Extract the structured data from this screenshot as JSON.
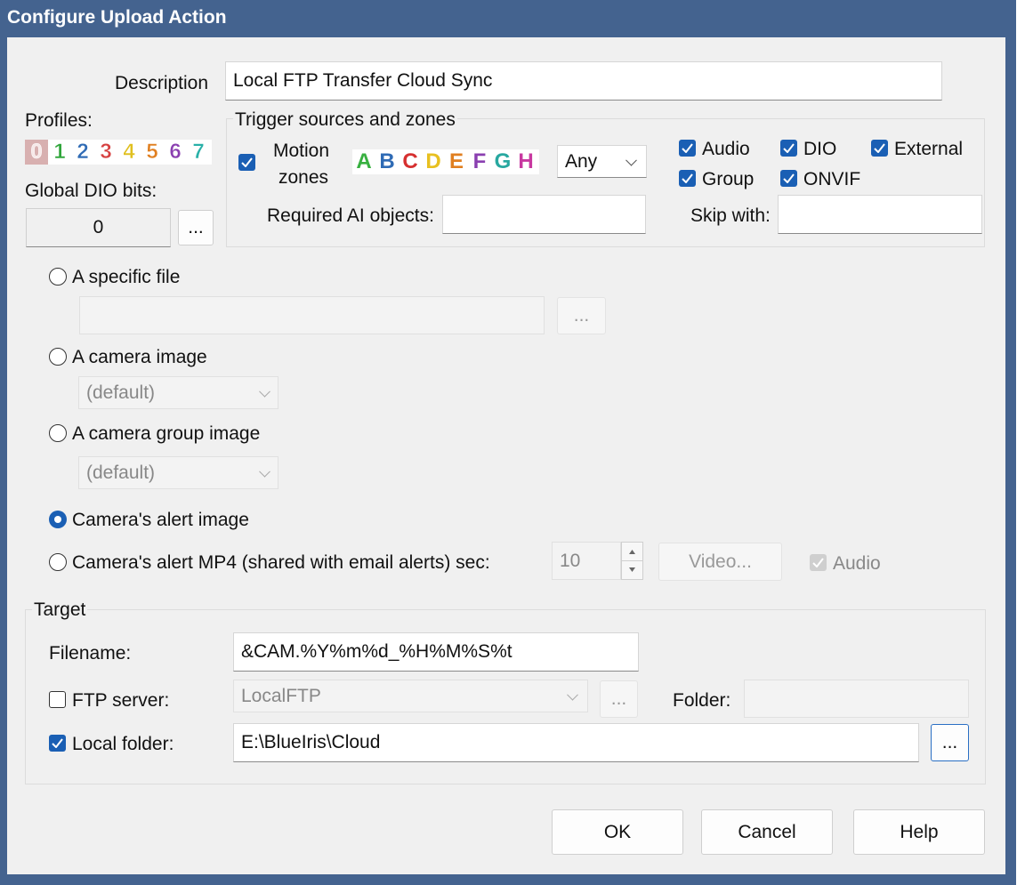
{
  "window": {
    "title": "Configure Upload Action"
  },
  "description": {
    "label": "Description",
    "value": "Local FTP Transfer Cloud Sync"
  },
  "profiles": {
    "label": "Profiles:",
    "digits": [
      "0",
      "1",
      "2",
      "3",
      "4",
      "5",
      "6",
      "7"
    ],
    "colors": [
      "#d8b0b0",
      "#2fa53a",
      "#2f6bb5",
      "#d64040",
      "#e0c020",
      "#e07f20",
      "#8a3fb0",
      "#28b0a8"
    ]
  },
  "global_dio": {
    "label": "Global DIO bits:",
    "value": "0",
    "button": "..."
  },
  "trigger": {
    "group_label": "Trigger sources and zones",
    "motion_label_1": "Motion",
    "motion_label_2": "zones",
    "zones": [
      "A",
      "B",
      "C",
      "D",
      "E",
      "F",
      "G",
      "H"
    ],
    "zone_colors": [
      "#38b040",
      "#2f6bb5",
      "#d63030",
      "#e8c020",
      "#e07f20",
      "#8a3fb0",
      "#28a8a0",
      "#c838a0"
    ],
    "zone_mode": "Any",
    "audio": "Audio",
    "dio": "DIO",
    "external": "External",
    "group": "Group",
    "onvif": "ONVIF",
    "required_ai_label": "Required AI objects:",
    "required_ai_value": "",
    "skip_with_label": "Skip with:",
    "skip_with_value": ""
  },
  "sources": {
    "specific_file": "A specific file",
    "specific_file_value": "",
    "browse": "...",
    "camera_image": "A camera image",
    "camera_image_select": "(default)",
    "camera_group_image": "A camera group image",
    "camera_group_select": "(default)",
    "alert_image": "Camera's alert image",
    "alert_mp4": "Camera's alert MP4 (shared with email alerts) sec:",
    "mp4_seconds": "10",
    "video_button": "Video...",
    "audio_label": "Audio"
  },
  "target": {
    "group_label": "Target",
    "filename_label": "Filename:",
    "filename_value": "&CAM.%Y%m%d_%H%M%S%t",
    "ftp_label": "FTP server:",
    "ftp_value": "LocalFTP",
    "ftp_browse": "...",
    "folder_label": "Folder:",
    "folder_value": "",
    "local_label": "Local folder:",
    "local_value": "E:\\BlueIris\\Cloud",
    "local_browse": "..."
  },
  "buttons": {
    "ok": "OK",
    "cancel": "Cancel",
    "help": "Help"
  },
  "colors": {
    "titlebar": "#44638f",
    "accent": "#1a5fb4",
    "dialog_bg": "#f0f0f0"
  }
}
